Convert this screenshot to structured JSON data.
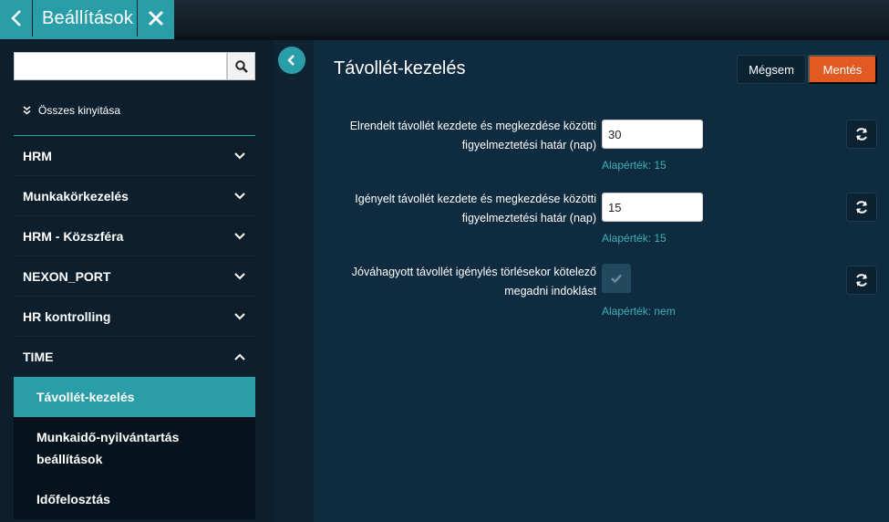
{
  "header": {
    "title": "Beállítások",
    "back_icon": "chevron-left-icon",
    "close_icon": "close-icon"
  },
  "sidebar": {
    "search": {
      "value": "",
      "placeholder": ""
    },
    "expand_all_label": "Összes kinyitása",
    "items": [
      {
        "label": "HRM",
        "expanded": false
      },
      {
        "label": "Munkakörkezelés",
        "expanded": false
      },
      {
        "label": "HRM - Közszféra",
        "expanded": false
      },
      {
        "label": "NEXON_PORT",
        "expanded": false
      },
      {
        "label": "HR kontrolling",
        "expanded": false
      },
      {
        "label": "TIME",
        "expanded": true
      }
    ],
    "subitems": [
      {
        "label": "Távollét-kezelés",
        "active": true
      },
      {
        "label": "Munkaidő-nyilvántartás beállítások",
        "active": false
      },
      {
        "label": "Időfelosztás",
        "active": false
      }
    ]
  },
  "main": {
    "title": "Távollét-kezelés",
    "cancel_label": "Mégsem",
    "save_label": "Mentés",
    "settings": [
      {
        "label": "Elrendelt távollét kezdete és megkezdése közötti figyelmeztetési határ (nap)",
        "value": "30",
        "default": "Alapérték: 15"
      },
      {
        "label": "Igényelt távollét kezdete és megkezdése közötti figyelmeztetési határ (nap)",
        "value": "15",
        "default": "Alapérték: 15"
      },
      {
        "label": "Jóváhagyott távollét igénylés törlésekor kötelező megadni indoklást",
        "checked": false,
        "default": "Alapérték: nem"
      }
    ]
  },
  "colors": {
    "accent": "#2a9ea8",
    "save": "#e25a22",
    "default_text": "#3fb0b8"
  }
}
